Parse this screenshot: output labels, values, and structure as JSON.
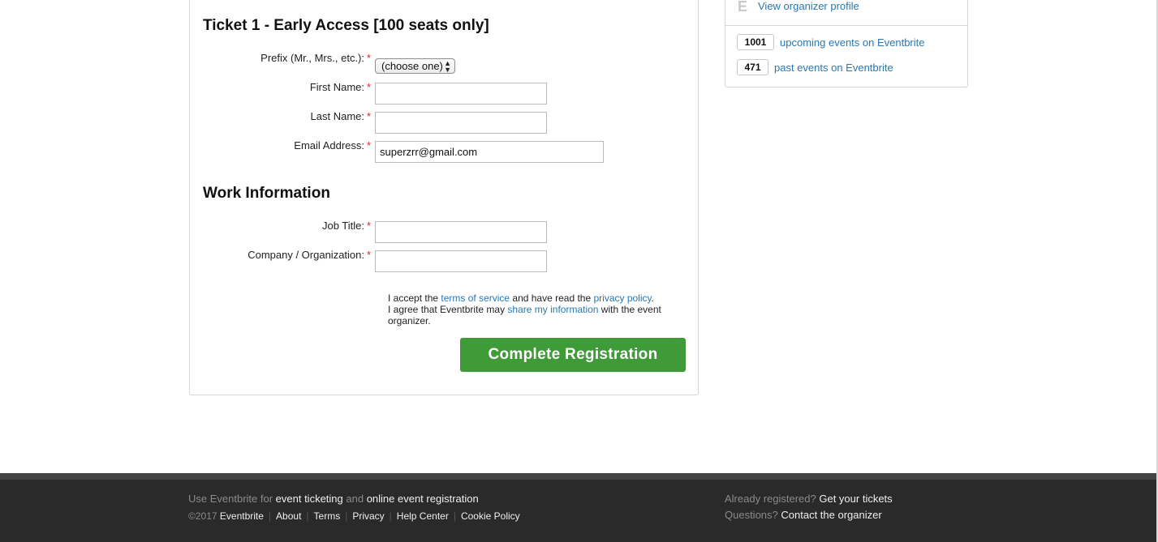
{
  "form": {
    "ticket_title": "Ticket 1 - Early Access [100 seats only]",
    "prefix": {
      "label": "Prefix (Mr., Mrs., etc.):",
      "selected": "(choose one)"
    },
    "first_name": {
      "label": "First Name:",
      "value": ""
    },
    "last_name": {
      "label": "Last Name:",
      "value": ""
    },
    "email": {
      "label": "Email Address:",
      "value": "superzrr@gmail.com"
    },
    "required_mark": "*",
    "work_title": "Work Information",
    "job_title": {
      "label": "Job Title:",
      "value": ""
    },
    "company": {
      "label": "Company / Organization:",
      "value": ""
    },
    "terms": {
      "t1": "I accept the ",
      "terms_link": "terms of service",
      "t2": " and have read the ",
      "privacy_link": "privacy policy",
      "t3": ".",
      "t4": "I agree that Eventbrite may ",
      "share_link": "share my information",
      "t5": " with the event organizer."
    },
    "submit_label": "Complete Registration"
  },
  "organizer": {
    "view_profile": "View organizer profile",
    "upcoming_count": "1001",
    "upcoming_label": "upcoming events on Eventbrite",
    "past_count": "471",
    "past_label": "past events on Eventbrite"
  },
  "footer": {
    "use_prefix": "Use Eventbrite for ",
    "event_ticketing": "event ticketing",
    "and": " and ",
    "online_registration": "online event registration",
    "copyright": "©2017",
    "eventbrite": "Eventbrite",
    "links": [
      "About",
      "Terms",
      "Privacy",
      "Help Center",
      "Cookie Policy"
    ],
    "already_registered": "Already registered?",
    "get_tickets": "Get your tickets",
    "questions": "Questions?",
    "contact": "Contact the organizer"
  },
  "colors": {
    "link": "#2978b0",
    "button_green": "#3f9a38",
    "required_red": "#d62828",
    "footer_bg": "#2a2a2a"
  }
}
